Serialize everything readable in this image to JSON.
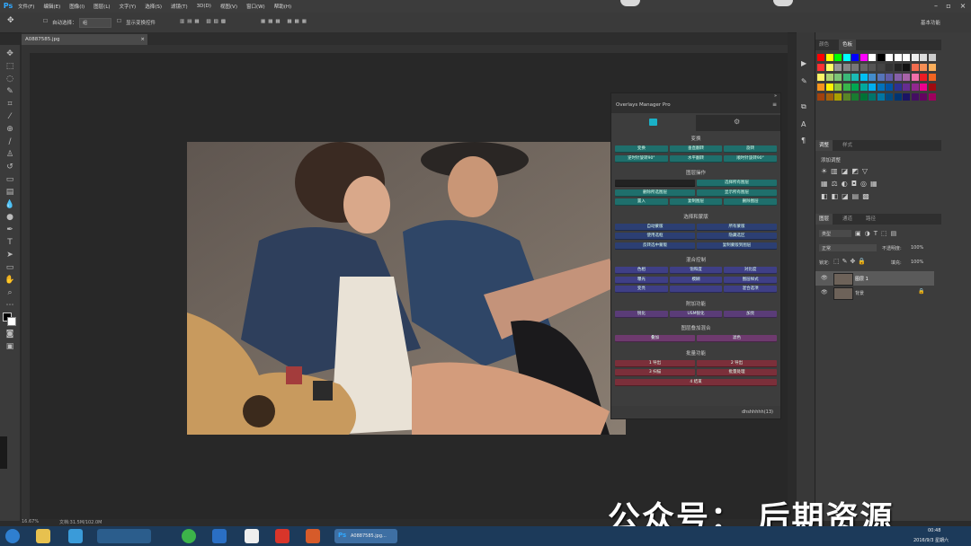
{
  "menu": {
    "app_icon": "Ps",
    "items": [
      "文件(F)",
      "编辑(E)",
      "图像(I)",
      "图层(L)",
      "文字(Y)",
      "选择(S)",
      "滤镜(T)",
      "3D(D)",
      "视图(V)",
      "窗口(W)",
      "帮助(H)"
    ]
  },
  "options_bar": {
    "auto_select_label": "自动选择：",
    "auto_select_value": "组",
    "show_transform_label": "显示变换控件",
    "workspace": "基本功能"
  },
  "document": {
    "tab_title": "A0887585.jpg"
  },
  "status": {
    "zoom": "16.67%",
    "doc_info": "文档:31.5M/102.0M"
  },
  "swatches_panel": {
    "tabs": [
      "颜色",
      "色板"
    ],
    "colors": [
      "#ff0000",
      "#ffff00",
      "#00ff00",
      "#00ffff",
      "#0000ff",
      "#ff00ff",
      "#ffffff",
      "#000000",
      "#ffffff",
      "#ffffff",
      "#ffffff",
      "#eeeeee",
      "#dddddd",
      "#cccccc",
      "#ff3333",
      "#ffff66",
      "#999999",
      "#888888",
      "#777777",
      "#666666",
      "#555555",
      "#444444",
      "#333333",
      "#222222",
      "#111111",
      "#f26c4f",
      "#f68e55",
      "#fbaf5c",
      "#fff467",
      "#acd372",
      "#7cc576",
      "#3bb878",
      "#1abbb4",
      "#00bff3",
      "#438ccb",
      "#5574b9",
      "#605ca8",
      "#855fa8",
      "#a763a8",
      "#f06ea9",
      "#ed1c24",
      "#f26522",
      "#f7941d",
      "#fff200",
      "#8dc63f",
      "#39b54a",
      "#00a651",
      "#00a99d",
      "#00aeef",
      "#0072bc",
      "#0054a6",
      "#2e3192",
      "#662d91",
      "#92278f",
      "#ec008c",
      "#9e0b0f",
      "#a0410d",
      "#a3620a",
      "#aba000",
      "#598527",
      "#197b30",
      "#007236",
      "#00746b",
      "#0076a3",
      "#004a80",
      "#003471",
      "#1b1464",
      "#440e62",
      "#630460",
      "#9e005d"
    ]
  },
  "adjust_panel": {
    "tabs": [
      "调整",
      "样式"
    ],
    "hint": "添加调整"
  },
  "layers_panel": {
    "tabs": [
      "图层",
      "通道",
      "路径"
    ],
    "kind_label": "类型",
    "mode": "正常",
    "opacity_label": "不透明度:",
    "opacity": "100%",
    "lock_label": "锁定:",
    "fill_label": "填充:",
    "fill": "100%",
    "layers": [
      {
        "name": "图层 1",
        "active": true
      },
      {
        "name": "背景",
        "active": false
      }
    ]
  },
  "overlays_panel": {
    "title": "Overlays Manager Pro",
    "sections": [
      {
        "title": "变换",
        "color": "teal",
        "rows": [
          [
            "变换",
            "垂直翻转",
            "旋转"
          ],
          [
            "逆时针旋转90°",
            "水平翻转",
            "顺时针旋转90°"
          ]
        ]
      },
      {
        "title": "图层操作",
        "color": "teal",
        "rows": [
          [
            "",
            "选择所有图层"
          ],
          [
            "删除所选图层",
            "显示所有图层"
          ],
          [
            "置入",
            "复制图层",
            "删除图层"
          ]
        ]
      },
      {
        "title": "选择和蒙版",
        "color": "navy",
        "rows": [
          [
            "自动蒙版",
            "所有蒙版"
          ],
          [
            "使用选框",
            "隐藏选区"
          ],
          [
            "反转选中蒙版",
            "复制蒙版到图层"
          ]
        ]
      },
      {
        "title": "混合控制",
        "color": "indigo",
        "rows": [
          [
            "色相",
            "饱和度",
            "对比度"
          ],
          [
            "曝光",
            "模糊",
            "图层样式"
          ],
          [
            "变亮",
            "",
            "混合选项"
          ]
        ]
      },
      {
        "title": "附加功能",
        "color": "purple",
        "rows": [
          [
            "锐化",
            "USM锐化",
            "加亮"
          ]
        ]
      },
      {
        "title": "图层叠加混合",
        "color": "plum",
        "rows": [
          [
            "叠加",
            "滤色"
          ]
        ]
      },
      {
        "title": "批量功能",
        "color": "red",
        "rows": [
          [
            "1 导出",
            "2 导出"
          ],
          [
            "3 扫描",
            "批量处理"
          ],
          [
            "4 结束"
          ]
        ]
      }
    ],
    "footer": "dhshhhhh(13)"
  },
  "watermark": "公众号： 后期资源",
  "taskbar": {
    "active_app": "A0887585.jpg...",
    "time": "00:48",
    "date": "2016/9/3 星期六"
  }
}
